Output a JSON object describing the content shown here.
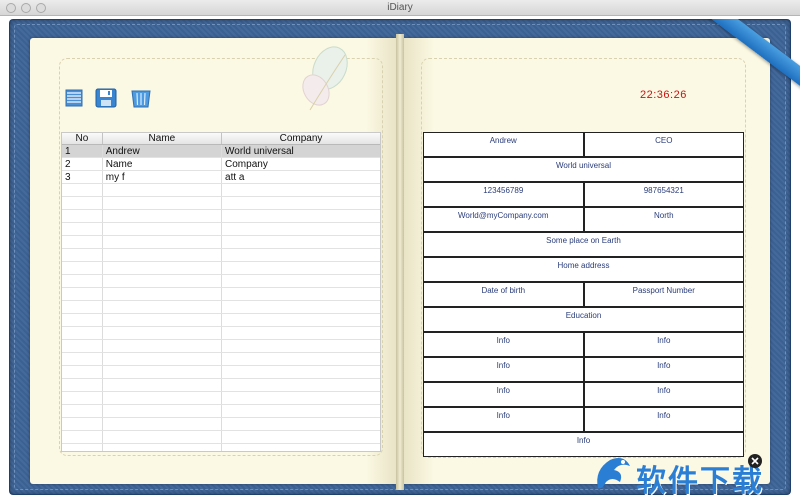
{
  "window": {
    "title": "iDiary"
  },
  "toolbar": {
    "icons": [
      "list-icon",
      "save-icon",
      "trash-icon"
    ]
  },
  "table": {
    "columns": [
      "No",
      "Name",
      "Company"
    ],
    "rows": [
      {
        "no": "1",
        "name": "Andrew",
        "company": "World universal"
      },
      {
        "no": "2",
        "name": "Name",
        "company": "Company"
      },
      {
        "no": "3",
        "name": "my f",
        "company": "att a"
      }
    ],
    "selected_row": 1
  },
  "clock": {
    "time": "22:36:26"
  },
  "detail": {
    "name": "Andrew",
    "title": "CEO",
    "company": "World universal",
    "phone1": "123456789",
    "phone2": "987654321",
    "email": "World@myCompany.com",
    "region": "North",
    "address": "Some place on Earth",
    "home_address": "Home address",
    "dob": "Date of birth",
    "passport": "Passport Number",
    "education": "Education",
    "info": [
      "Info",
      "Info",
      "Info",
      "Info",
      "Info",
      "Info",
      "Info",
      "Info",
      "Info"
    ]
  },
  "watermark": {
    "text": "软件下载"
  },
  "colors": {
    "cover": "#3d6497",
    "page": "#fbf8e3",
    "clock": "#cc1111",
    "cell_text": "#2a3d7a",
    "ribbon": "#2b83d6"
  }
}
